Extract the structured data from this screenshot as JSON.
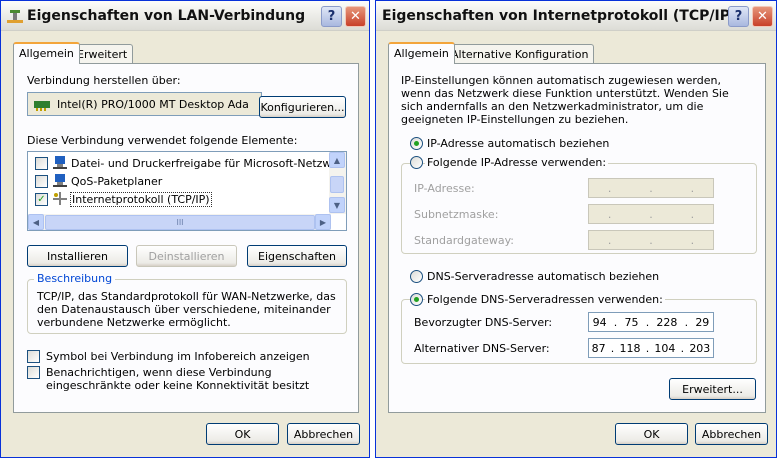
{
  "left": {
    "title": "Eigenschaften von LAN-Verbindung",
    "tabs": [
      "Allgemein",
      "Erweitert"
    ],
    "connect_via_label": "Verbindung herstellen über:",
    "adapter_name": "Intel(R) PRO/1000 MT Desktop Ada",
    "configure_button": "Konfigurieren...",
    "elements_label": "Diese Verbindung verwendet folgende Elemente:",
    "items": [
      {
        "label": "Datei- und Druckerfreigabe für Microsoft-Netzwerke",
        "checked": false
      },
      {
        "label": "QoS-Paketplaner",
        "checked": false
      },
      {
        "label": "Internetprotokoll (TCP/IP)",
        "checked": true
      }
    ],
    "scroll_grip": "III",
    "install_button": "Installieren",
    "uninstall_button": "Deinstallieren",
    "properties_button": "Eigenschaften",
    "description_title": "Beschreibung",
    "description_text": "TCP/IP, das Standardprotokoll für WAN-Netzwerke, das den Datenaustausch über verschiedene, miteinander verbundene Netzwerke ermöglicht.",
    "show_icon_label": "Symbol bei Verbindung im Infobereich anzeigen",
    "notify_label": "Benachrichtigen, wenn diese Verbindung eingeschränkte oder keine Konnektivität besitzt",
    "ok_button": "OK",
    "cancel_button": "Abbrechen"
  },
  "right": {
    "title": "Eigenschaften von Internetprotokoll (TCP/IP)",
    "tabs": [
      "Allgemein",
      "Alternative Konfiguration"
    ],
    "intro_text": "IP-Einstellungen können automatisch zugewiesen werden, wenn das Netzwerk diese Funktion unterstützt. Wenden Sie sich andernfalls an den Netzwerkadministrator, um die geeigneten IP-Einstellungen zu beziehen.",
    "ip_auto_label": "IP-Adresse automatisch beziehen",
    "ip_manual_label": "Folgende IP-Adresse verwenden:",
    "ip_address_label": "IP-Adresse:",
    "subnet_label": "Subnetzmaske:",
    "gateway_label": "Standardgateway:",
    "ip_dot": ".",
    "dns_auto_label": "DNS-Serveradresse automatisch beziehen",
    "dns_manual_label": "Folgende DNS-Serveradressen verwenden:",
    "preferred_dns_label": "Bevorzugter DNS-Server:",
    "preferred_dns": [
      "94",
      "75",
      "228",
      "29"
    ],
    "alternate_dns_label": "Alternativer DNS-Server:",
    "alternate_dns": [
      "87",
      "118",
      "104",
      "203"
    ],
    "advanced_button": "Erweitert...",
    "ok_button": "OK",
    "cancel_button": "Abbrechen"
  },
  "colors": {
    "accent_green": "#21a121",
    "group_title_blue": "#0046d5",
    "tab_highlight": "#f3a53b"
  }
}
